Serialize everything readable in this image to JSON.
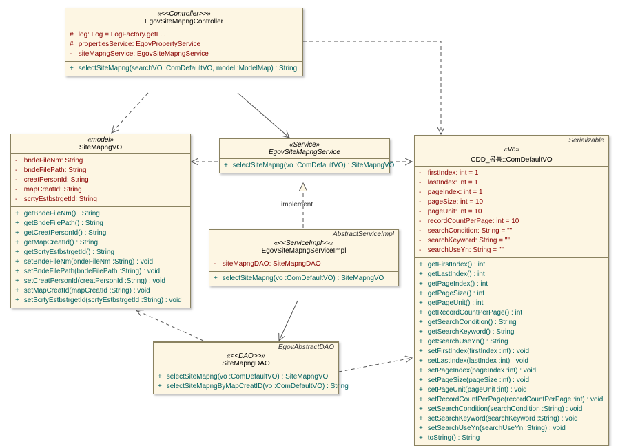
{
  "controller": {
    "stereo": "«<<Controller>>»",
    "name": "EgovSiteMapngController",
    "attrs": [
      [
        "#",
        "log:  Log = LogFactory.getL..."
      ],
      [
        "#",
        "propertiesService:  EgovPropertyService"
      ],
      [
        "-",
        "siteMapngService:  EgovSiteMapngService"
      ]
    ],
    "ops": [
      [
        "+",
        "selectSiteMapng(searchVO :ComDefaultVO, model :ModelMap) : String"
      ]
    ]
  },
  "model": {
    "stereo": "«model»",
    "name": "SiteMapngVO",
    "attrs": [
      [
        "-",
        "bndeFileNm:  String"
      ],
      [
        "-",
        "bndeFilePath:  String"
      ],
      [
        "-",
        "creatPersonId:  String"
      ],
      [
        "-",
        "mapCreatId:  String"
      ],
      [
        "-",
        "scrtyEstbstrgetId:  String"
      ]
    ],
    "ops": [
      [
        "+",
        "getBndeFileNm() : String"
      ],
      [
        "+",
        "getBndeFilePath() : String"
      ],
      [
        "+",
        "getCreatPersonId() : String"
      ],
      [
        "+",
        "getMapCreatId() : String"
      ],
      [
        "+",
        "getScrtyEstbstrgetId() : String"
      ],
      [
        "+",
        "setBndeFileNm(bndeFileNm :String) : void"
      ],
      [
        "+",
        "setBndeFilePath(bndeFilePath :String) : void"
      ],
      [
        "+",
        "setCreatPersonId(creatPersonId :String) : void"
      ],
      [
        "+",
        "setMapCreatId(mapCreatId :String) : void"
      ],
      [
        "+",
        "setScrtyEstbstrgetId(scrtyEstbstrgetId :String) : void"
      ]
    ]
  },
  "service": {
    "stereo": "«Service»",
    "name": "EgovSiteMapngService",
    "italic": true,
    "ops": [
      [
        "+",
        "selectSiteMapng(vo :ComDefaultVO) : SiteMapngVO"
      ]
    ]
  },
  "serviceImpl": {
    "corner": "AbstractServiceImpl",
    "stereo": "«<<ServiceImpl>>»",
    "name": "EgovSiteMapngServiceImpl",
    "attrs": [
      [
        "-",
        "siteMapngDAO:  SiteMapngDAO"
      ]
    ],
    "ops": [
      [
        "+",
        "selectSiteMapng(vo :ComDefaultVO) : SiteMapngVO"
      ]
    ]
  },
  "dao": {
    "corner": "EgovAbstractDAO",
    "stereo": "«<<DAO>>»",
    "name": "SiteMapngDAO",
    "ops": [
      [
        "+",
        "selectSiteMapng(vo :ComDefaultVO) : SiteMapngVO"
      ],
      [
        "+",
        "selectSiteMapngByMapCreatID(vo :ComDefaultVO) : String"
      ]
    ]
  },
  "vo": {
    "corner": "Serializable",
    "stereo": "«Vo»",
    "name": "CDD_공통::ComDefaultVO",
    "attrs": [
      [
        "-",
        "firstIndex:  int = 1"
      ],
      [
        "-",
        "lastIndex:  int = 1"
      ],
      [
        "-",
        "pageIndex:  int = 1"
      ],
      [
        "-",
        "pageSize:  int = 10"
      ],
      [
        "-",
        "pageUnit:  int = 10"
      ],
      [
        "-",
        "recordCountPerPage:  int = 10"
      ],
      [
        "-",
        "searchCondition:  String = \"\""
      ],
      [
        "-",
        "searchKeyword:  String = \"\""
      ],
      [
        "-",
        "searchUseYn:  String = \"\""
      ]
    ],
    "ops": [
      [
        "+",
        "getFirstIndex() : int"
      ],
      [
        "+",
        "getLastIndex() : int"
      ],
      [
        "+",
        "getPageIndex() : int"
      ],
      [
        "+",
        "getPageSize() : int"
      ],
      [
        "+",
        "getPageUnit() : int"
      ],
      [
        "+",
        "getRecordCountPerPage() : int"
      ],
      [
        "+",
        "getSearchCondition() : String"
      ],
      [
        "+",
        "getSearchKeyword() : String"
      ],
      [
        "+",
        "getSearchUseYn() : String"
      ],
      [
        "+",
        "setFirstIndex(firstIndex :int) : void"
      ],
      [
        "+",
        "setLastIndex(lastIndex :int) : void"
      ],
      [
        "+",
        "setPageIndex(pageIndex :int) : void"
      ],
      [
        "+",
        "setPageSize(pageSize :int) : void"
      ],
      [
        "+",
        "setPageUnit(pageUnit :int) : void"
      ],
      [
        "+",
        "setRecordCountPerPage(recordCountPerPage :int) : void"
      ],
      [
        "+",
        "setSearchCondition(searchCondition :String) : void"
      ],
      [
        "+",
        "setSearchKeyword(searchKeyword :String) : void"
      ],
      [
        "+",
        "setSearchUseYn(searchUseYn :String) : void"
      ],
      [
        "+",
        "toString() : String"
      ]
    ]
  },
  "labels": {
    "implement": "implement"
  }
}
